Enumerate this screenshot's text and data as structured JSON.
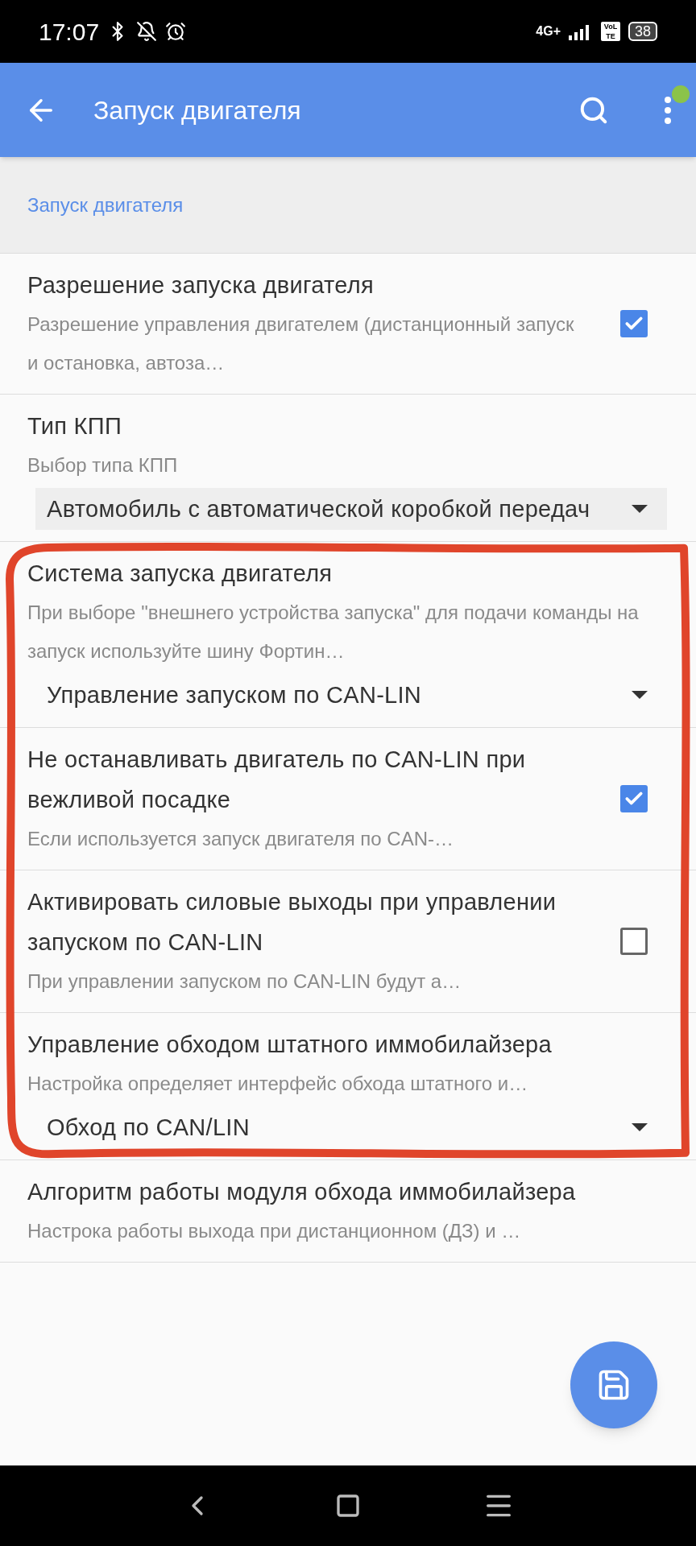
{
  "status_bar": {
    "time": "17:07",
    "network": "4G+",
    "volte": "VoLTE",
    "battery": "38"
  },
  "app_bar": {
    "title": "Запуск двигателя"
  },
  "section": {
    "title": "Запуск двигателя"
  },
  "items": [
    {
      "kind": "checkbox",
      "title": "Разрешение запуска двигателя",
      "subtitle": "Разрешение управления двигателем (дистанционный запуск и остановка, автоза…",
      "checked": true
    },
    {
      "kind": "dropdown",
      "title": "Тип КПП",
      "subtitle": "Выбор типа КПП",
      "value": "Автомобиль с автоматической коробкой передач"
    },
    {
      "kind": "dropdown",
      "title": "Система запуска двигателя",
      "subtitle": "При выборе \"внешнего устройства запуска\" для подачи команды на запуск используйте шину Фортин…",
      "value": "Управление запуском по CAN-LIN"
    },
    {
      "kind": "checkbox",
      "title": "Не останавливать двигатель по CAN-LIN при вежливой посадке",
      "subtitle": "Если используется запуск двигателя по CAN-…",
      "checked": true
    },
    {
      "kind": "checkbox",
      "title": "Активировать силовые выходы при управлении запуском по CAN-LIN",
      "subtitle": "При управлении запуском по CAN-LIN будут а…",
      "checked": false
    },
    {
      "kind": "dropdown",
      "title": "Управление обходом штатного иммобилайзера",
      "subtitle": "Настройка определяет интерфейс обхода штатного и…",
      "value": "Обход по CAN/LIN"
    },
    {
      "kind": "plain",
      "title": "Алгоритм работы модуля обхода иммобилайзера",
      "subtitle": "Настрока работы выхода при дистанционном (ДЗ) и …"
    }
  ]
}
